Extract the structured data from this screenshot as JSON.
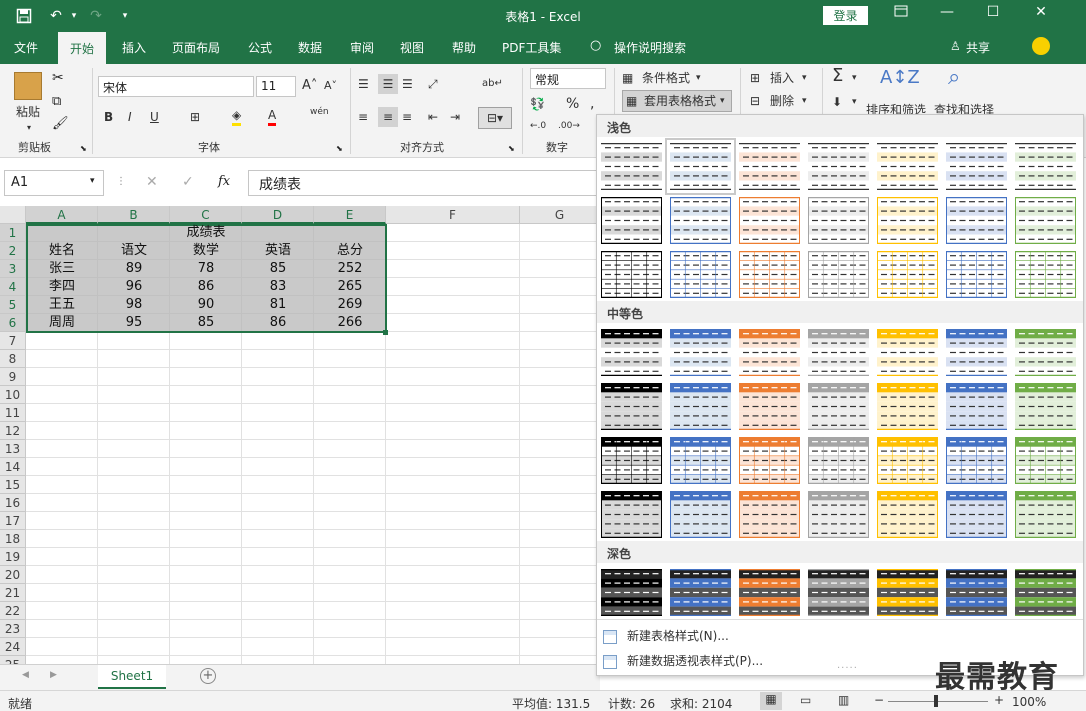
{
  "window": {
    "title": "表格1 - Excel",
    "login_label": "登录",
    "share_label": "共享"
  },
  "tabs": [
    "文件",
    "开始",
    "插入",
    "页面布局",
    "公式",
    "数据",
    "审阅",
    "视图",
    "帮助",
    "PDF工具集",
    "操作说明搜索"
  ],
  "ribbon": {
    "paste_label": "粘贴",
    "clipboard_group": "剪贴板",
    "font_name": "宋体",
    "font_size": "11",
    "font_group": "字体",
    "align_group": "对齐方式",
    "number_format": "常规",
    "number_group": "数字",
    "conditional_format": "条件格式",
    "format_as_table": "套用表格格式",
    "insert_label": "插入",
    "delete_label": "删除",
    "sort_filter": "排序和筛选",
    "find_select": "查找和选择",
    "wen": "wén",
    "bold": "B",
    "italic": "I",
    "underline": "U"
  },
  "formula_bar": {
    "name_box": "A1",
    "fx": "fx",
    "content": "成绩表"
  },
  "columns": [
    "A",
    "B",
    "C",
    "D",
    "E",
    "F",
    "G"
  ],
  "rows": [
    "1",
    "2",
    "3",
    "4",
    "5",
    "6",
    "7",
    "8",
    "9",
    "10",
    "11",
    "12",
    "13",
    "14",
    "15",
    "16",
    "17",
    "18",
    "19",
    "20",
    "21",
    "22",
    "23",
    "24",
    "25"
  ],
  "sheet_table": {
    "title": "成绩表",
    "headers": [
      "姓名",
      "语文",
      "数学",
      "英语",
      "总分"
    ],
    "data": [
      [
        "张三",
        "89",
        "78",
        "85",
        "252"
      ],
      [
        "李四",
        "96",
        "86",
        "83",
        "265"
      ],
      [
        "王五",
        "98",
        "90",
        "81",
        "269"
      ],
      [
        "周周",
        "95",
        "85",
        "86",
        "266"
      ]
    ]
  },
  "sheet_tab": "Sheet1",
  "status": {
    "ready": "就绪",
    "average": "平均值: 131.5",
    "count": "计数: 26",
    "sum": "求和: 2104",
    "zoom": "100%"
  },
  "gallery": {
    "categories": [
      "浅色",
      "中等色",
      "深色"
    ],
    "new_table_style": "新建表格样式(N)...",
    "new_pivot_style": "新建数据透视表样式(P)...",
    "palette": [
      "#000000",
      "#4472c4",
      "#ed7d31",
      "#a5a5a5",
      "#ffc000",
      "#4472c4",
      "#70ad47"
    ],
    "palette_light": [
      "#d9d9d9",
      "#dce6f1",
      "#fce4d6",
      "#ededed",
      "#fff2cc",
      "#d9e1f2",
      "#e2efda"
    ]
  },
  "watermark": "最需教育",
  "accent": "#217346"
}
